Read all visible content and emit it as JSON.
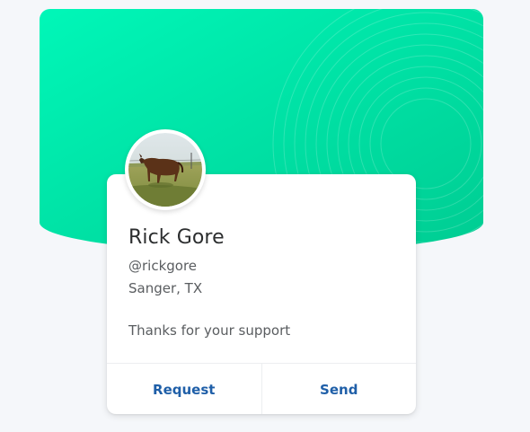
{
  "profile": {
    "name": "Rick Gore",
    "handle": "@rickgore",
    "location": "Sanger, TX",
    "message": "Thanks for your support",
    "avatar_icon": "horse-photo"
  },
  "actions": {
    "request_label": "Request",
    "send_label": "Send"
  },
  "colors": {
    "hero_gradient_start": "#00f5b4",
    "hero_gradient_end": "#00cf94",
    "action_link": "#1f5fa8",
    "background": "#f5f7fa"
  }
}
